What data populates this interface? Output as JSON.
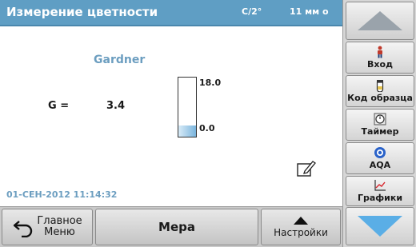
{
  "header": {
    "title": "Измерение цветности",
    "mode": "C/2°",
    "time": "11 мм о"
  },
  "main": {
    "method": "Gardner",
    "result_label": "G =",
    "result_value": "3.4",
    "scale": {
      "max_label": "18.0",
      "min_label": "0.0",
      "level_fraction": 0.19
    },
    "datetime": "01-СЕН-2012 11:14:32"
  },
  "bottom": {
    "home_line1": "Главное",
    "home_line2": "Меню",
    "measure": "Мера",
    "settings": "Настройки"
  },
  "sidebar": {
    "items": [
      {
        "label": "Вход",
        "icon": "user-icon"
      },
      {
        "label": "Код образца",
        "icon": "sample-vial-icon"
      },
      {
        "label": "Таймер",
        "icon": "timer-icon"
      },
      {
        "label": "AQA",
        "icon": "aqa-icon"
      },
      {
        "label": "Графики",
        "icon": "graph-icon"
      }
    ]
  },
  "colors": {
    "title_bar": "#5f9ec4",
    "accent_text": "#6c9ec0",
    "scroll_down": "#5aaee6",
    "scroll_up": "#9aa3ab"
  }
}
